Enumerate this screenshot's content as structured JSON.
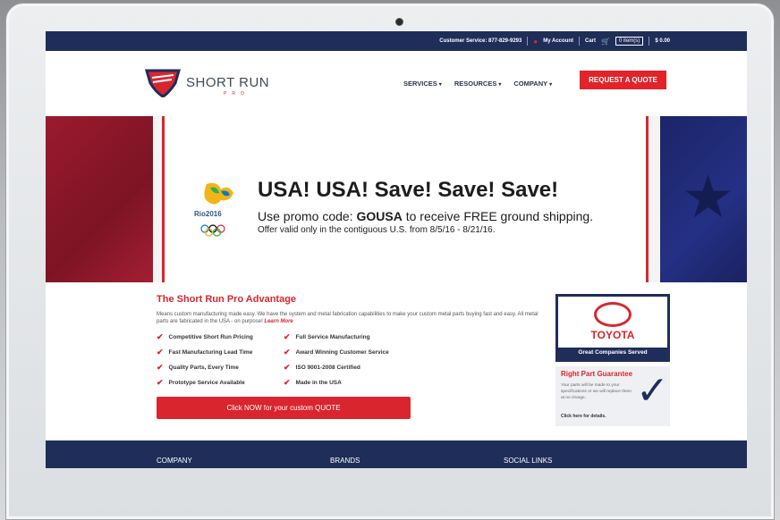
{
  "topbar": {
    "customer_service": "Customer Service: 877-829-9293",
    "my_account": "My Account",
    "cart": "Cart",
    "items": "0 item(s)",
    "total": "$ 0.00"
  },
  "header": {
    "logo_text": "SHORT RUN",
    "logo_sub": "PRO",
    "nav": [
      "SERVICES",
      "RESOURCES",
      "COMPANY"
    ],
    "quote_button": "REQUEST A QUOTE"
  },
  "hero": {
    "rio_text": "Rio2016",
    "title": "USA! USA! Save! Save! Save!",
    "line2_prefix": "Use promo code: ",
    "promo_code": "GOUSA",
    "line2_suffix": " to receive FREE ground shipping.",
    "line3": "Offer valid only in the contiguous U.S. from 8/5/16 - 8/21/16."
  },
  "advantage": {
    "title": "The Short Run Pro Advantage",
    "desc": "Means custom manufacturing made easy. We have the system and metal fabrication capabilities to make your custom metal parts buying fast and easy. All metal parts are fabricated in the USA - on purpose!",
    "learn_more": "Learn More",
    "features": [
      "Competitive Short Run Pricing",
      "Full Service Manufacturing",
      "Fast Manufacturing Lead Time",
      "Award Winning Customer Service",
      "Quality Parts, Every Time",
      "ISO 9001-2008 Certified",
      "Prototype Service Available",
      "Made in the USA"
    ],
    "cta": "Click NOW for your custom QUOTE"
  },
  "toyota": {
    "brand": "TOYOTA",
    "caption": "Great Companies Served"
  },
  "guarantee": {
    "title": "Right Part Guarantee",
    "text": "Your parts will be made to your specifications or we will replace them at no charge.",
    "link": "Click here for details."
  },
  "footer": {
    "cols": [
      "COMPANY",
      "BRANDS",
      "SOCIAL LINKS"
    ]
  },
  "colors": {
    "navy": "#1f2d59",
    "red": "#d9262e"
  }
}
